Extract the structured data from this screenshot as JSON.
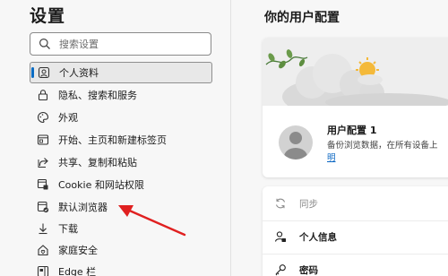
{
  "sidebar": {
    "title": "设置",
    "search_placeholder": "搜索设置",
    "items": [
      {
        "label": "个人资料",
        "icon": "profile-icon",
        "active": true
      },
      {
        "label": "隐私、搜索和服务",
        "icon": "lock-icon"
      },
      {
        "label": "外观",
        "icon": "appearance-icon"
      },
      {
        "label": "开始、主页和新建标签页",
        "icon": "start-page-icon"
      },
      {
        "label": "共享、复制和粘贴",
        "icon": "share-icon"
      },
      {
        "label": "Cookie 和网站权限",
        "icon": "site-permissions-icon"
      },
      {
        "label": "默认浏览器",
        "icon": "default-browser-icon"
      },
      {
        "label": "下载",
        "icon": "download-icon"
      },
      {
        "label": "家庭安全",
        "icon": "family-icon"
      },
      {
        "label": "Edge 栏",
        "icon": "edge-bar-icon"
      }
    ]
  },
  "main": {
    "title": "你的用户配置",
    "profile": {
      "name": "用户配置 1",
      "description": "备份浏览数据，在所有设备上",
      "link": "明"
    },
    "rows": [
      {
        "label": "同步",
        "icon": "sync-icon",
        "muted": true
      },
      {
        "label": "个人信息",
        "icon": "personal-info-icon"
      },
      {
        "label": "密码",
        "icon": "key-icon"
      }
    ]
  },
  "colors": {
    "accent": "#0a6cc4",
    "arrow": "#e02020"
  }
}
